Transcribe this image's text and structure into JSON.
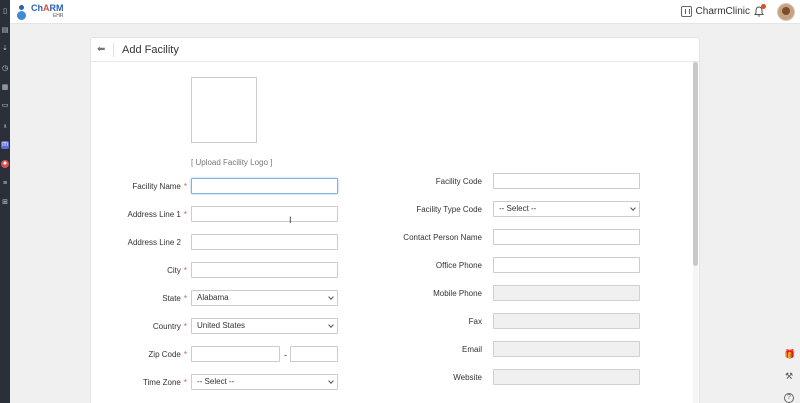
{
  "app": {
    "logo_name_a": "Ch",
    "logo_name_r": "A",
    "logo_name_b": "RM",
    "logo_sub": "EHR",
    "clinic_name": "CharmClinic"
  },
  "page": {
    "title": "Add Facility",
    "upload_logo": "[ Upload Facility Logo ]"
  },
  "form_left": [
    {
      "id": "facility-name",
      "label": "Facility Name",
      "required": true,
      "value": "",
      "kind": "text"
    },
    {
      "id": "address-line-1",
      "label": "Address Line 1",
      "required": true,
      "value": "",
      "kind": "text"
    },
    {
      "id": "address-line-2",
      "label": "Address Line 2",
      "required": false,
      "value": "",
      "kind": "text"
    },
    {
      "id": "city",
      "label": "City",
      "required": true,
      "value": "",
      "kind": "text"
    },
    {
      "id": "state",
      "label": "State",
      "required": true,
      "value": "Alabama",
      "kind": "select"
    },
    {
      "id": "country",
      "label": "Country",
      "required": true,
      "value": "United States",
      "kind": "select"
    },
    {
      "id": "zip-code",
      "label": "Zip Code",
      "required": true,
      "value": "",
      "kind": "zip"
    },
    {
      "id": "time-zone",
      "label": "Time Zone",
      "required": true,
      "value": "-- Select --",
      "kind": "select"
    }
  ],
  "zip_separator": "-",
  "form_right": [
    {
      "id": "facility-code",
      "label": "Facility Code",
      "value": "",
      "kind": "text",
      "disabled": false
    },
    {
      "id": "facility-type-code",
      "label": "Facility Type Code",
      "value": "-- Select --",
      "kind": "select",
      "disabled": false
    },
    {
      "id": "contact-person-name",
      "label": "Contact Person Name",
      "value": "",
      "kind": "text",
      "disabled": false
    },
    {
      "id": "office-phone",
      "label": "Office Phone",
      "value": "",
      "kind": "text",
      "disabled": false
    },
    {
      "id": "mobile-phone",
      "label": "Mobile Phone",
      "value": "",
      "kind": "text",
      "disabled": true
    },
    {
      "id": "fax",
      "label": "Fax",
      "value": "",
      "kind": "text",
      "disabled": true
    },
    {
      "id": "email",
      "label": "Email",
      "value": "",
      "kind": "text",
      "disabled": true
    },
    {
      "id": "website",
      "label": "Website",
      "value": "",
      "kind": "text",
      "disabled": true
    }
  ],
  "required_mark": "*",
  "icons": {
    "back": "arrow-left-icon",
    "notifications": "bell-icon",
    "clinic": "building-icon",
    "gift": "gift-icon",
    "tools": "tools-icon",
    "help": "help-icon"
  },
  "colors": {
    "brand_blue": "#2d5fb8",
    "required": "#d9534f",
    "sidebar": "#2b2f3a",
    "focus": "#7fb3e3"
  }
}
